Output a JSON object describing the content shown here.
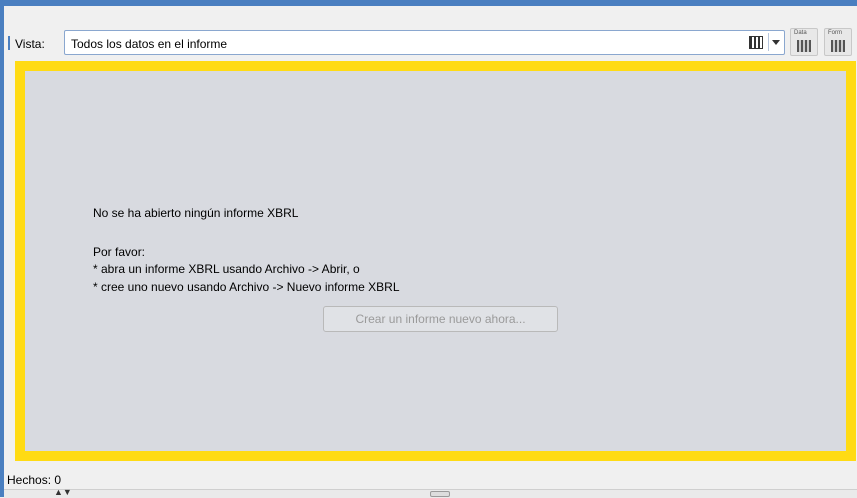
{
  "toolbar": {
    "view_label": "Vista:",
    "view_value": "Todos los datos en el informe",
    "btn1_caption": "Data",
    "btn2_caption": "Form"
  },
  "panel": {
    "title": "No se ha abierto ningún informe XBRL",
    "please": "Por favor:",
    "bullet1": " * abra un informe XBRL usando Archivo -> Abrir, o",
    "bullet2": " * cree uno nuevo usando Archivo -> Nuevo informe XBRL",
    "create_button": "Crear un informe nuevo ahora..."
  },
  "status": {
    "facts": "Hechos: 0"
  },
  "colors": {
    "accent_border": "#ffdb14",
    "frame_blue": "#4a7fc0",
    "panel_bg": "#d8dae0"
  }
}
